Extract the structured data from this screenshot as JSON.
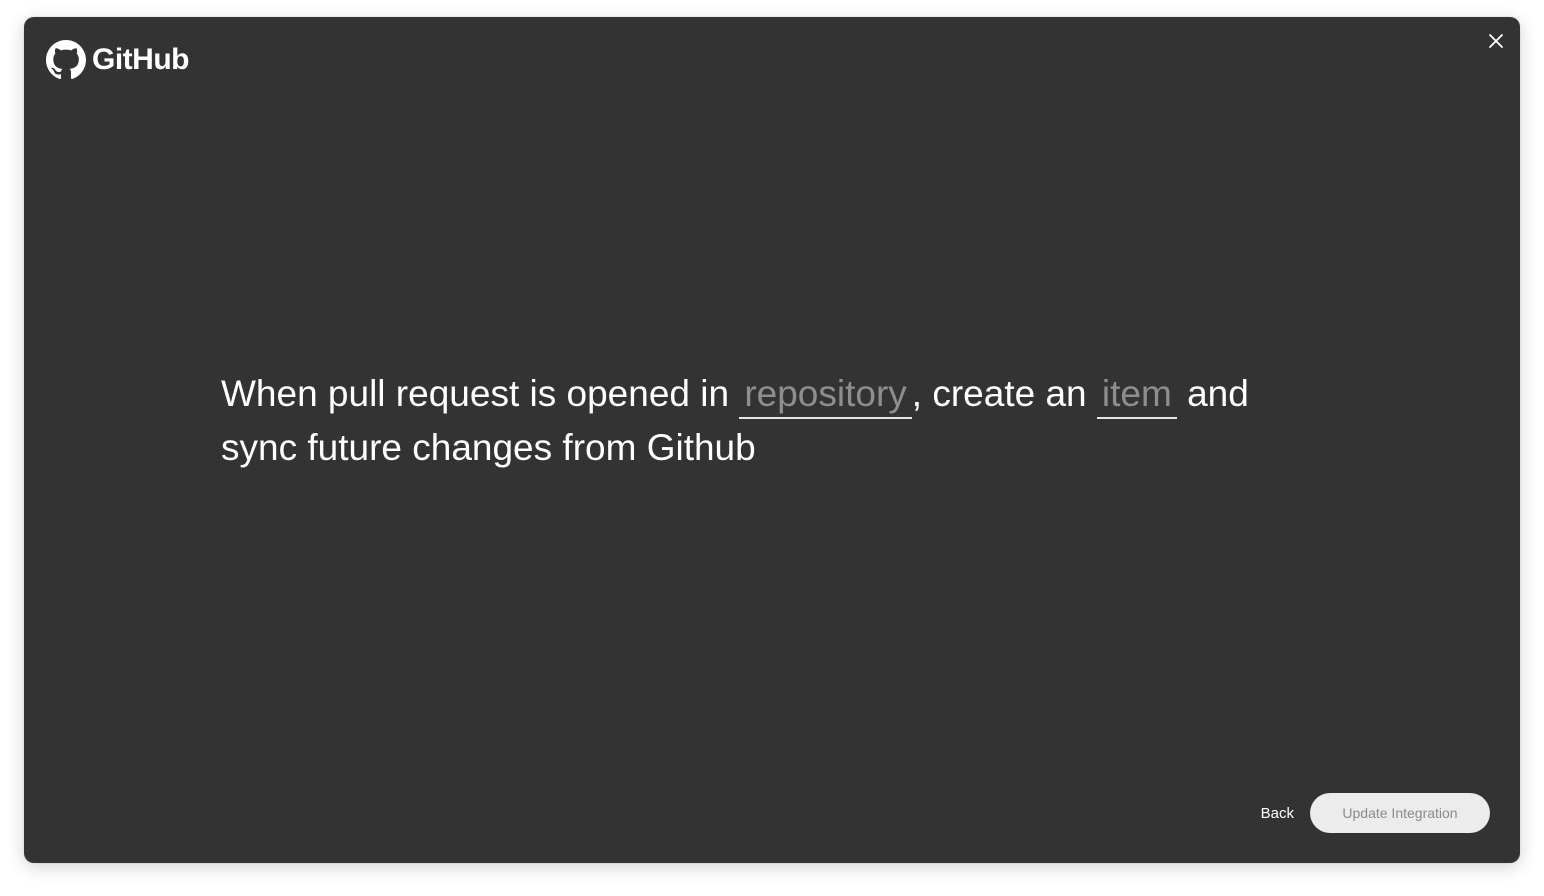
{
  "header": {
    "logo_text": "GitHub",
    "logo_icon": "github-octocat-icon",
    "close_icon": "close-icon"
  },
  "recipe": {
    "part1": "When pull request is opened in ",
    "slot_repository": "repository",
    "part2": ", create an ",
    "slot_item": "item",
    "part3": " and sync future changes from Github"
  },
  "footer": {
    "back_label": "Back",
    "update_label": "Update Integration"
  },
  "colors": {
    "modal_bg": "#333333",
    "text": "#ffffff",
    "placeholder": "#8e8e8e",
    "button_bg": "#ececec",
    "button_text": "#8a8a8a"
  }
}
